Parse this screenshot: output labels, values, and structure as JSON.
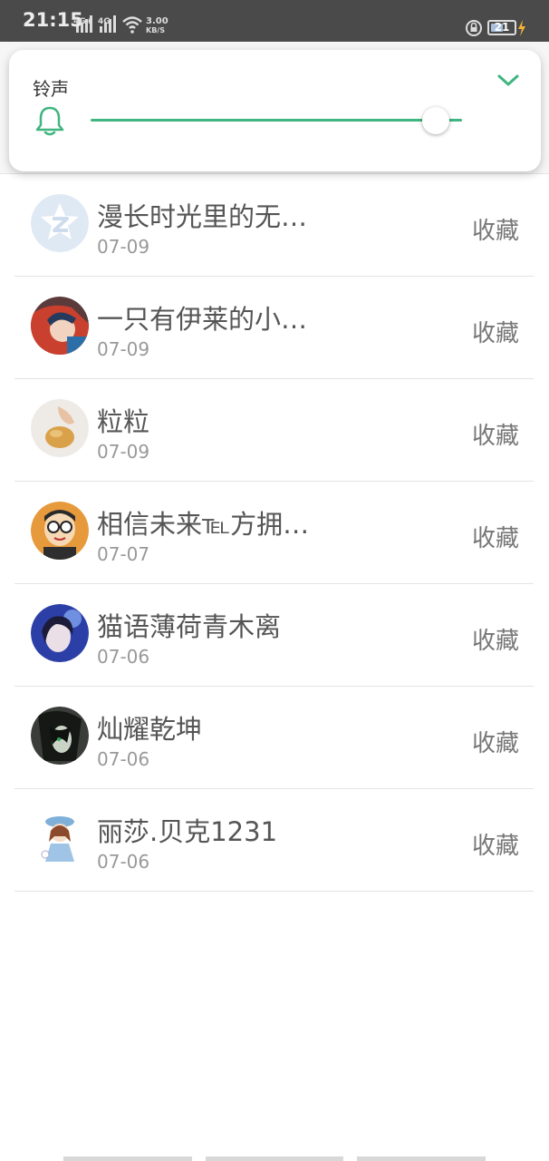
{
  "status_bar": {
    "time": "21:15",
    "sim1_label": "4G+",
    "sim2_label": "4G",
    "speed_value": "3.00",
    "speed_unit": "KB/S",
    "battery_level": "21"
  },
  "volume_panel": {
    "title": "铃声",
    "level_fraction": 0.93,
    "accent_color": "#3fb57f",
    "icons": [
      "bell-icon",
      "chevron-down-icon"
    ]
  },
  "list": {
    "items": [
      {
        "name": "漫长时光里的无…",
        "date": "07-09",
        "action": "收藏",
        "avatar": "qzone-default"
      },
      {
        "name": "一只有伊莱的小…",
        "date": "07-09",
        "action": "收藏",
        "avatar": "anime-character"
      },
      {
        "name": "粒粒",
        "date": "07-09",
        "action": "收藏",
        "avatar": "hand-holding-bun"
      },
      {
        "name": "相信未来℡方拥…",
        "date": "07-07",
        "action": "收藏",
        "avatar": "cartoon-boy-glasses"
      },
      {
        "name": "猫语薄荷青木离",
        "date": "07-06",
        "action": "收藏",
        "avatar": "girl-portrait"
      },
      {
        "name": "灿耀乾坤",
        "date": "07-06",
        "action": "收藏",
        "avatar": "dark-anime-character"
      },
      {
        "name": "丽莎.贝克1231",
        "date": "07-06",
        "action": "收藏",
        "avatar": "chibi-girl"
      }
    ]
  }
}
